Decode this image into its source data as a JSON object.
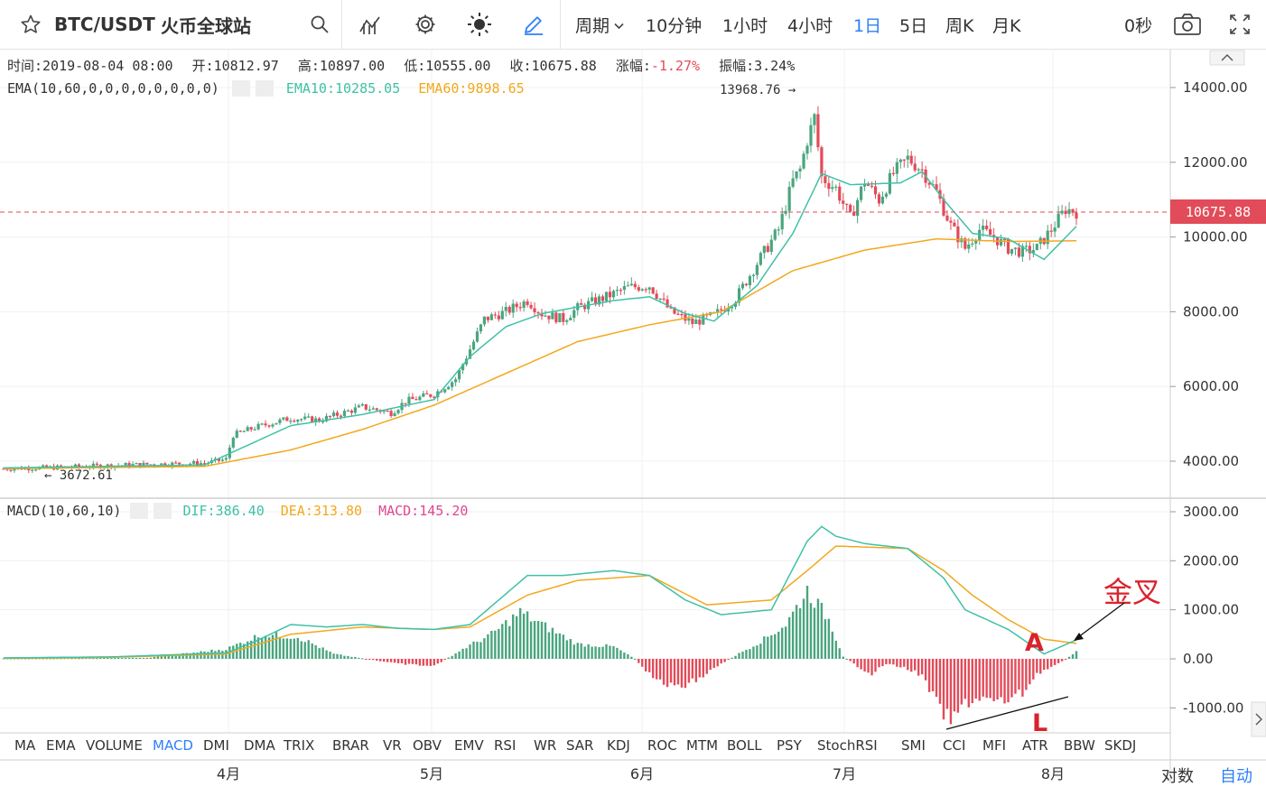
{
  "toolbar": {
    "symbol": "BTC/USDT",
    "exchange": "火币全球站",
    "period_label": "周期",
    "periods": [
      "10分钟",
      "1小时",
      "4小时",
      "1日",
      "5日",
      "周K",
      "月K"
    ],
    "active_period": "1日",
    "timer": "0秒"
  },
  "ohlc": {
    "time": "时间:2019-08-04 08:00",
    "open": "开:10812.97",
    "high": "高:10897.00",
    "low": "低:10555.00",
    "close": "收:10675.88",
    "change_label": "涨幅:",
    "change_value": "-1.27%",
    "amplitude": "振幅:3.24%"
  },
  "ema": {
    "label": "EMA(10,60,0,0,0,0,0,0,0,0)",
    "ema10": "EMA10:10285.05",
    "ema60": "EMA60:9898.65"
  },
  "macd": {
    "label": "MACD(10,60,10)",
    "dif": "DIF:386.40",
    "dea": "DEA:313.80",
    "macd": "MACD:145.20"
  },
  "annotations": {
    "max_price": "13968.76 →",
    "min_price": "← 3672.61",
    "last_price": "10675.88",
    "golden_cross": "金叉",
    "point_a": "A",
    "point_l": "L"
  },
  "indicators": [
    "MA",
    "EMA",
    "VOLUME",
    "MACD",
    "DMI",
    "DMA",
    "TRIX",
    "BRAR",
    "VR",
    "OBV",
    "EMV",
    "RSI",
    "WR",
    "SAR",
    "KDJ",
    "ROC",
    "MTM",
    "BOLL",
    "PSY",
    "StochRSI",
    "SMI",
    "CCI",
    "MFI",
    "ATR",
    "BBW",
    "SKDJ"
  ],
  "active_indicator": "MACD",
  "footer": {
    "log_scale": "对数",
    "auto": "自动"
  },
  "colors": {
    "up": "#4aa57f",
    "down": "#e24b59",
    "ema10": "#3fc1a6",
    "ema60": "#f2a81d",
    "macd": "#e0468f",
    "accent": "#2d7ff9"
  },
  "chart_data": [
    {
      "type": "candlestick",
      "title": "BTC/USDT",
      "x_ticks": [
        "4月",
        "5月",
        "6月",
        "7月",
        "8月"
      ],
      "y_ticks": [
        "14000.00",
        "12000.00",
        "10000.00",
        "8000.00",
        "6000.00",
        "4000.00"
      ],
      "ylim": [
        3200,
        14700
      ],
      "max_marker": 13968.76,
      "min_marker": 3672.61,
      "last_price": 10675.88,
      "close_points": [
        [
          0,
          3800
        ],
        [
          14,
          3830
        ],
        [
          28,
          3880
        ],
        [
          42,
          3920
        ],
        [
          56,
          3950
        ],
        [
          62,
          4050
        ],
        [
          64,
          4700
        ],
        [
          70,
          4900
        ],
        [
          80,
          5150
        ],
        [
          88,
          5100
        ],
        [
          100,
          5450
        ],
        [
          108,
          5300
        ],
        [
          112,
          5600
        ],
        [
          120,
          5800
        ],
        [
          126,
          6200
        ],
        [
          134,
          7800
        ],
        [
          140,
          8000
        ],
        [
          146,
          8300
        ],
        [
          150,
          7950
        ],
        [
          156,
          7800
        ],
        [
          160,
          8100
        ],
        [
          168,
          8400
        ],
        [
          174,
          8650
        ],
        [
          180,
          8700
        ],
        [
          186,
          8000
        ],
        [
          192,
          7700
        ],
        [
          198,
          7900
        ],
        [
          204,
          8350
        ],
        [
          210,
          9300
        ],
        [
          216,
          10200
        ],
        [
          220,
          11500
        ],
        [
          222,
          11800
        ],
        [
          224,
          12600
        ],
        [
          226,
          13200
        ],
        [
          228,
          11600
        ],
        [
          232,
          11300
        ],
        [
          236,
          10500
        ],
        [
          240,
          11500
        ],
        [
          244,
          11000
        ],
        [
          248,
          11700
        ],
        [
          252,
          12100
        ],
        [
          256,
          11800
        ],
        [
          260,
          11200
        ],
        [
          264,
          10300
        ],
        [
          268,
          9700
        ],
        [
          272,
          10200
        ],
        [
          276,
          10000
        ],
        [
          280,
          9700
        ],
        [
          284,
          9600
        ],
        [
          288,
          9700
        ],
        [
          292,
          10200
        ],
        [
          296,
          10750
        ],
        [
          299,
          10675.88
        ]
      ],
      "ema10_points": [
        [
          0,
          3820
        ],
        [
          56,
          3900
        ],
        [
          64,
          4250
        ],
        [
          80,
          4950
        ],
        [
          100,
          5250
        ],
        [
          120,
          5650
        ],
        [
          130,
          6800
        ],
        [
          140,
          7600
        ],
        [
          150,
          7950
        ],
        [
          170,
          8300
        ],
        [
          180,
          8400
        ],
        [
          190,
          7950
        ],
        [
          198,
          7750
        ],
        [
          210,
          8700
        ],
        [
          220,
          10100
        ],
        [
          228,
          11700
        ],
        [
          236,
          11400
        ],
        [
          250,
          11450
        ],
        [
          256,
          11750
        ],
        [
          262,
          11000
        ],
        [
          270,
          10100
        ],
        [
          280,
          9950
        ],
        [
          290,
          9400
        ],
        [
          299,
          10285.05
        ]
      ],
      "ema60_points": [
        [
          0,
          3800
        ],
        [
          56,
          3860
        ],
        [
          80,
          4300
        ],
        [
          100,
          4850
        ],
        [
          120,
          5500
        ],
        [
          140,
          6350
        ],
        [
          160,
          7200
        ],
        [
          180,
          7650
        ],
        [
          200,
          8000
        ],
        [
          220,
          9100
        ],
        [
          240,
          9650
        ],
        [
          260,
          9950
        ],
        [
          280,
          9880
        ],
        [
          299,
          9898.65
        ]
      ]
    },
    {
      "type": "bar",
      "title": "MACD(10,60,10)",
      "y_ticks": [
        "3000.00",
        "2000.00",
        "1000.00",
        "0.00",
        "-1000.00"
      ],
      "ylim": [
        -1550,
        3100
      ],
      "dif_points": [
        [
          0,
          20
        ],
        [
          30,
          40
        ],
        [
          62,
          120
        ],
        [
          70,
          350
        ],
        [
          80,
          700
        ],
        [
          90,
          650
        ],
        [
          100,
          700
        ],
        [
          110,
          620
        ],
        [
          120,
          600
        ],
        [
          130,
          700
        ],
        [
          138,
          1200
        ],
        [
          146,
          1700
        ],
        [
          156,
          1700
        ],
        [
          170,
          1800
        ],
        [
          180,
          1700
        ],
        [
          190,
          1200
        ],
        [
          200,
          900
        ],
        [
          214,
          1000
        ],
        [
          224,
          2400
        ],
        [
          228,
          2700
        ],
        [
          232,
          2500
        ],
        [
          240,
          2350
        ],
        [
          252,
          2250
        ],
        [
          262,
          1650
        ],
        [
          268,
          1000
        ],
        [
          280,
          600
        ],
        [
          290,
          100
        ],
        [
          299,
          386.4
        ]
      ],
      "dea_points": [
        [
          0,
          10
        ],
        [
          30,
          30
        ],
        [
          62,
          100
        ],
        [
          80,
          500
        ],
        [
          100,
          650
        ],
        [
          120,
          600
        ],
        [
          130,
          650
        ],
        [
          146,
          1300
        ],
        [
          160,
          1600
        ],
        [
          180,
          1700
        ],
        [
          196,
          1100
        ],
        [
          214,
          1200
        ],
        [
          224,
          1800
        ],
        [
          232,
          2300
        ],
        [
          252,
          2250
        ],
        [
          262,
          1800
        ],
        [
          270,
          1300
        ],
        [
          280,
          800
        ],
        [
          290,
          400
        ],
        [
          299,
          313.8
        ]
      ],
      "hist_points": [
        [
          0,
          10
        ],
        [
          40,
          20
        ],
        [
          62,
          200
        ],
        [
          72,
          500
        ],
        [
          82,
          450
        ],
        [
          92,
          100
        ],
        [
          100,
          10
        ],
        [
          110,
          -100
        ],
        [
          120,
          -150
        ],
        [
          128,
          200
        ],
        [
          136,
          500
        ],
        [
          144,
          950
        ],
        [
          150,
          700
        ],
        [
          160,
          300
        ],
        [
          170,
          250
        ],
        [
          176,
          0
        ],
        [
          182,
          -450
        ],
        [
          188,
          -600
        ],
        [
          194,
          -400
        ],
        [
          200,
          -100
        ],
        [
          206,
          150
        ],
        [
          212,
          400
        ],
        [
          218,
          700
        ],
        [
          224,
          1400
        ],
        [
          230,
          800
        ],
        [
          234,
          50
        ],
        [
          238,
          -150
        ],
        [
          242,
          -300
        ],
        [
          246,
          -100
        ],
        [
          252,
          -200
        ],
        [
          256,
          -350
        ],
        [
          260,
          -900
        ],
        [
          264,
          -1300
        ],
        [
          268,
          -900
        ],
        [
          272,
          -800
        ],
        [
          278,
          -900
        ],
        [
          284,
          -700
        ],
        [
          288,
          -300
        ],
        [
          294,
          -100
        ],
        [
          299,
          145.2
        ]
      ]
    }
  ]
}
